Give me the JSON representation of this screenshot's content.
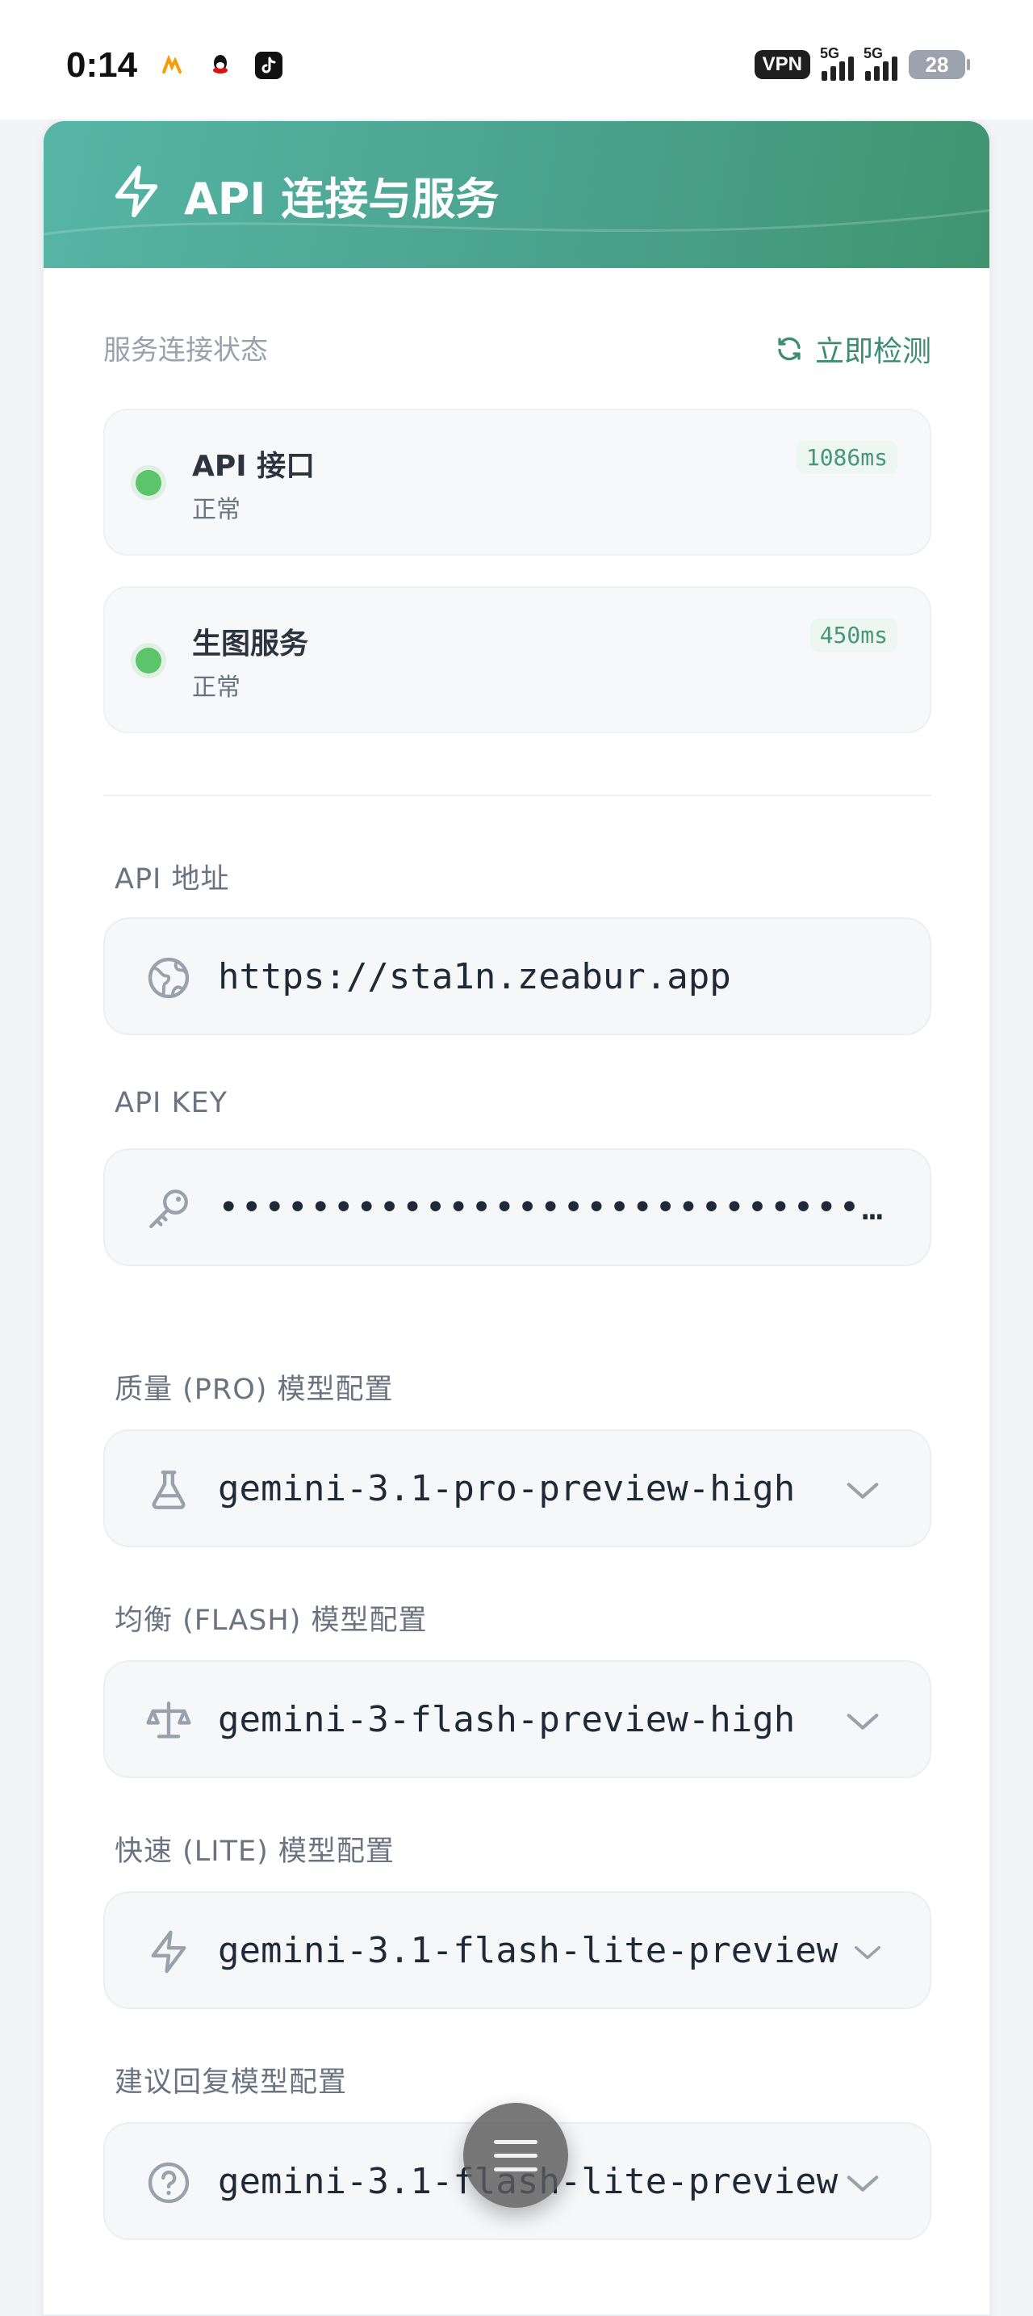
{
  "status_bar": {
    "time": "0:14",
    "vpn_label": "VPN",
    "signal_1_label": "5G",
    "signal_2_label": "5G",
    "battery": "28"
  },
  "card": {
    "title": "API 连接与服务",
    "title_icon": "lightning-icon"
  },
  "services": {
    "section_label": "服务连接状态",
    "recheck_label": "立即检测",
    "items": [
      {
        "name": "API 接口",
        "status": "正常",
        "latency": "1086ms"
      },
      {
        "name": "生图服务",
        "status": "正常",
        "latency": "450ms"
      }
    ]
  },
  "fields": {
    "api_url": {
      "label": "API 地址",
      "value": "https://sta1n.zeabur.app",
      "icon": "globe-icon"
    },
    "api_key": {
      "label": "API KEY",
      "value": "••••••••••••••••••••••••••••••••",
      "icon": "key-icon"
    },
    "pro_model": {
      "label": "质量 (PRO) 模型配置",
      "value": "gemini-3.1-pro-preview-high",
      "icon": "flask-icon"
    },
    "flash_model": {
      "label": "均衡 (FLASH) 模型配置",
      "value": "gemini-3-flash-preview-high",
      "icon": "scale-icon"
    },
    "lite_model": {
      "label": "快速 (LITE) 模型配置",
      "value": "gemini-3.1-flash-lite-preview",
      "icon": "lightning-icon"
    },
    "reply_model": {
      "label": "建议回复模型配置",
      "value": "gemini-3.1-flash-lite-preview",
      "icon": "help-circle-icon"
    }
  },
  "colors": {
    "header_gradient_start": "#56b5a5",
    "header_gradient_end": "#3f9570",
    "accent": "#3c8c74",
    "status_ok": "#5cc46a"
  }
}
